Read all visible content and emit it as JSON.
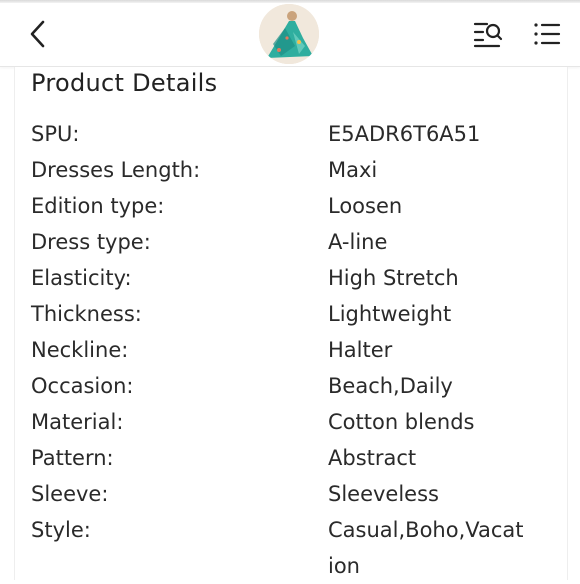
{
  "header": {
    "back_icon": "chevron-left-icon",
    "avatar_icon": "product-thumbnail",
    "search_list_icon": "search-list-icon",
    "menu_icon": "menu-list-icon"
  },
  "section": {
    "title": "Product Details"
  },
  "details": [
    {
      "label": "SPU:",
      "value": "E5ADR6T6A51"
    },
    {
      "label": "Dresses Length:",
      "value": "Maxi"
    },
    {
      "label": "Edition type:",
      "value": "Loosen"
    },
    {
      "label": "Dress type:",
      "value": "A-line"
    },
    {
      "label": "Elasticity:",
      "value": "High Stretch"
    },
    {
      "label": "Thickness:",
      "value": "Lightweight"
    },
    {
      "label": "Neckline:",
      "value": "Halter"
    },
    {
      "label": "Occasion:",
      "value": "Beach,Daily"
    },
    {
      "label": "Material:",
      "value": "Cotton blends"
    },
    {
      "label": "Pattern:",
      "value": "Abstract"
    },
    {
      "label": "Sleeve:",
      "value": "Sleeveless"
    },
    {
      "label": "Style:",
      "value": "Casual,Boho,Vacation"
    }
  ],
  "colors": {
    "text": "#222222",
    "divider": "#e6e6e6",
    "dress_teal": "#2fae9f"
  }
}
